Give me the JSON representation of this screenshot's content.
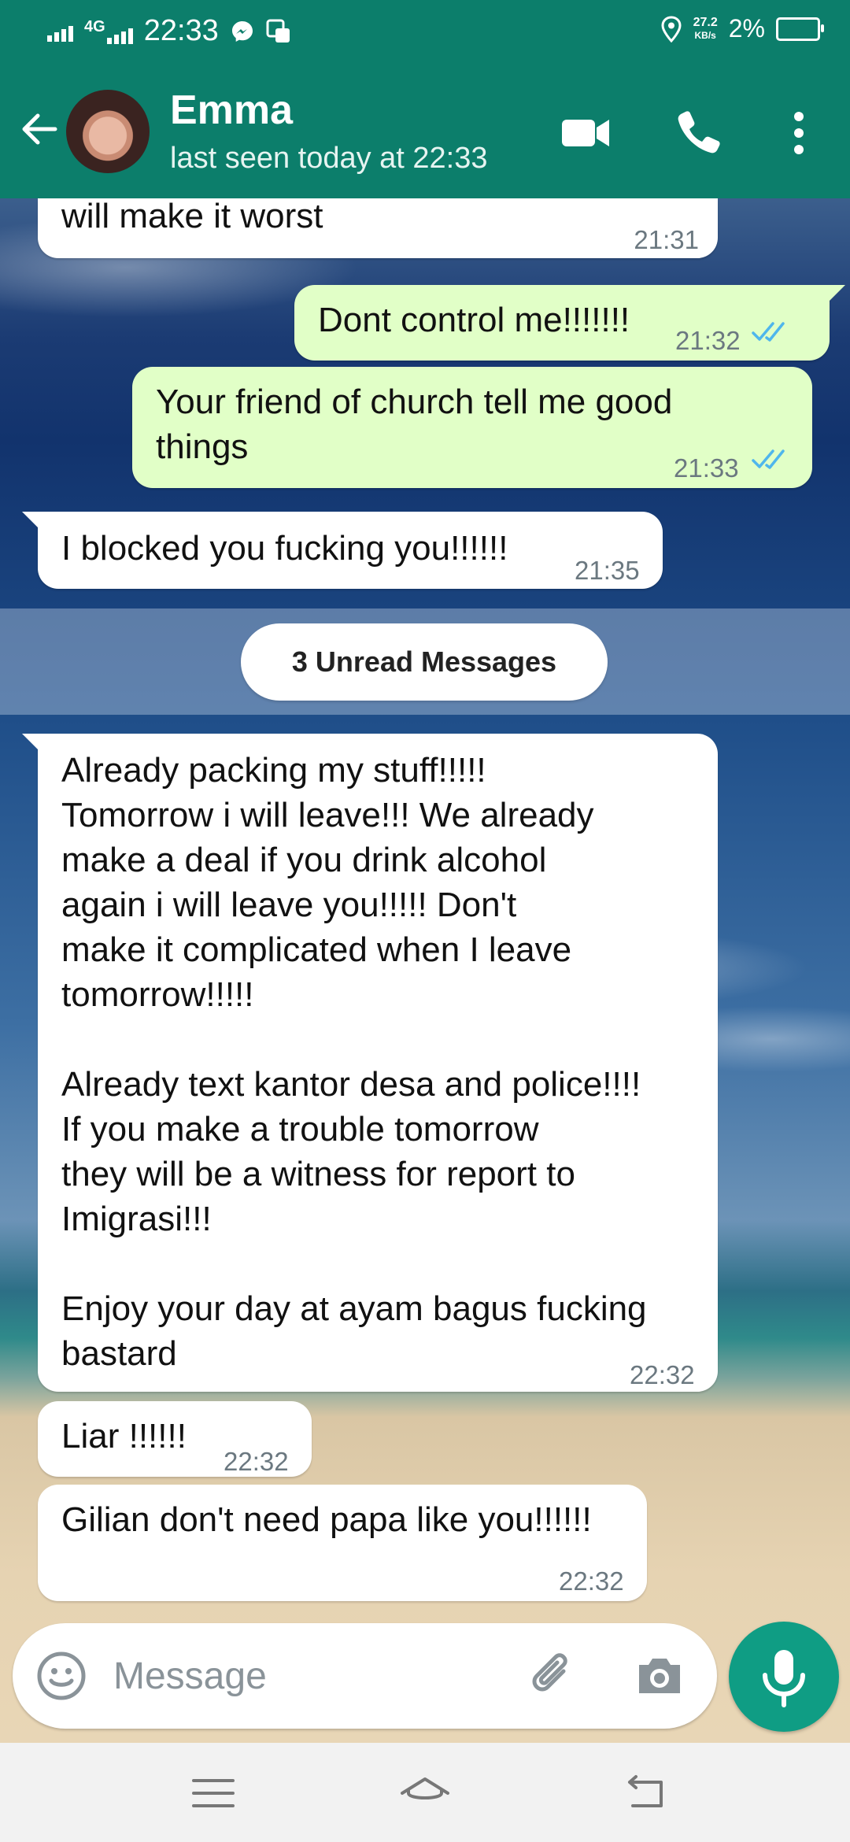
{
  "status_bar": {
    "network": "4G",
    "time": "22:33",
    "speed_value": "27.2",
    "speed_unit": "KB/s",
    "battery": "2%"
  },
  "header": {
    "contact_name": "Emma",
    "last_seen": "last seen today at 22:33"
  },
  "messages": [
    {
      "direction": "incoming",
      "text": "will make it worst",
      "time": "21:31"
    },
    {
      "direction": "outgoing",
      "text": "Dont control me!!!!!!!",
      "time": "21:32",
      "status": "read"
    },
    {
      "direction": "outgoing",
      "text": "Your friend of church tell me good\nthings",
      "time": "21:33",
      "status": "read"
    },
    {
      "direction": "incoming",
      "text": "I blocked you fucking you!!!!!!",
      "time": "21:35"
    },
    {
      "direction": "incoming",
      "text": "Already packing my stuff!!!!!\nTomorrow i will leave!!! We already\nmake a deal if you drink alcohol\nagain i will leave you!!!!! Don't\nmake it complicated when I leave\ntomorrow!!!!!\n\nAlready text kantor desa and police!!!!\nIf you make a trouble tomorrow\nthey will be a witness for report to\nImigrasi!!!\n\nEnjoy your day at ayam bagus fucking\nbastard",
      "time": "22:32"
    },
    {
      "direction": "incoming",
      "text": "Liar !!!!!!",
      "time": "22:32"
    },
    {
      "direction": "incoming",
      "text": "Gilian don't need papa like you!!!!!!",
      "time": "22:32"
    }
  ],
  "unread_divider": "3 Unread Messages",
  "composer": {
    "placeholder": "Message"
  },
  "colors": {
    "app_bar": "#0c7e6b",
    "outgoing_bubble": "#e1ffc7",
    "incoming_bubble": "#ffffff",
    "read_ticks": "#4fb6ec",
    "mic_button": "#0f9d84"
  },
  "icons": [
    "back-arrow-icon",
    "video-call-icon",
    "voice-call-icon",
    "more-options-icon",
    "emoji-icon",
    "attach-icon",
    "camera-icon",
    "mic-icon",
    "menu-icon",
    "home-icon",
    "back-nav-icon"
  ]
}
